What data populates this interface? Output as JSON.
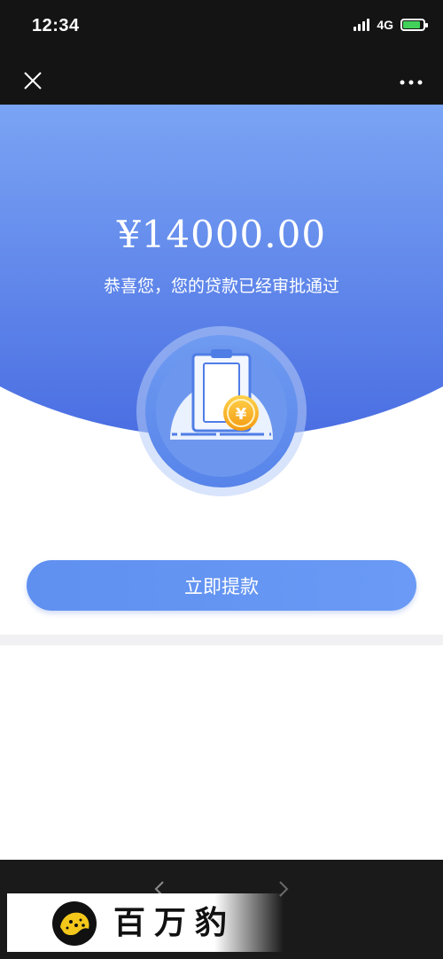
{
  "status_bar": {
    "time": "12:34",
    "network": "4G",
    "signal_bars": 4,
    "battery_level": 0.85
  },
  "nav": {
    "close_icon": "close-icon",
    "more_icon": "more-icon"
  },
  "hero": {
    "amount": "¥14000.00",
    "message": "恭喜您，您的贷款已经审批通过"
  },
  "actions": {
    "withdraw_label": "立即提款"
  },
  "watermark": {
    "brand": "百万豹"
  },
  "colors": {
    "primary_blue": "#5f90f0",
    "hero_top": "#7aa4f4",
    "hero_bottom": "#4a6ee2",
    "coin": "#f6b21b"
  }
}
